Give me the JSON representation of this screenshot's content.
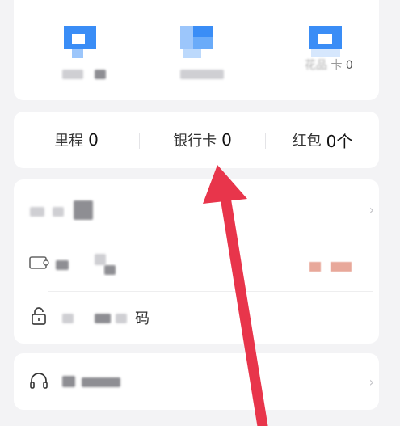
{
  "stats": {
    "mileage_label": "里程",
    "mileage_value": "0",
    "bank_card_label": "银行卡",
    "bank_card_value": "0",
    "red_packet_label": "红包",
    "red_packet_value": "0个"
  },
  "top_row": {
    "item3_label_partial": "卡",
    "item3_value": "0"
  },
  "menu": {
    "row3_label_tail": "码"
  },
  "colors": {
    "accent_blue": "#2f86f6",
    "arrow_red": "#e8354b",
    "badge": "#e8a89a"
  },
  "icons": {
    "row2": "coupon-icon",
    "row3": "lock-icon",
    "support": "headset-icon",
    "chevron": "chevron-right-icon"
  }
}
